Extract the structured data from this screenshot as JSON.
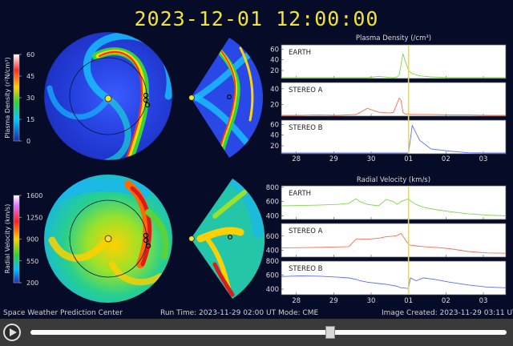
{
  "header": {
    "timestamp": "2023-12-01 12:00:00"
  },
  "footer": {
    "org": "Space Weather Prediction Center",
    "run_time": "Run Time: 2023-11-29 02:00 UT",
    "mode": "Mode: CME",
    "image_created": "Image Created: 2023-11-29 03:11 UT"
  },
  "colorbars": [
    {
      "label": "Plasma Density (r²N/cm³)",
      "ticks": [
        "60",
        "45",
        "30",
        "15",
        "0"
      ]
    },
    {
      "label": "Radial Velocity (km/s)",
      "ticks": [
        "1600",
        "1250",
        "900",
        "550",
        "200"
      ]
    }
  ],
  "colors": {
    "title": "#f2e23a",
    "earth": "#7fd84a",
    "stereo_a": "#ff6b55",
    "stereo_b": "#5a6cff",
    "now_line": "#e8e03a"
  },
  "icons": {
    "play": "play-icon"
  },
  "player": {
    "progress": 0.63
  },
  "chart_data": [
    {
      "type": "line",
      "title": "Plasma Density (/cm³)",
      "x_ticks": [
        "28",
        "29",
        "30",
        "01",
        "02",
        "03",
        "04"
      ],
      "x": [
        0,
        0.5,
        1,
        1.5,
        2,
        2.3,
        2.6,
        2.9,
        3.0,
        3.1,
        3.15,
        3.2,
        3.25,
        3.3,
        3.4,
        3.5,
        3.7,
        4,
        4.5,
        5,
        5.5,
        6
      ],
      "now_x": 3.4,
      "panels": [
        {
          "name": "EARTH",
          "color": "#7fd84a",
          "ylim": [
            5,
            68
          ],
          "yticks": [
            60,
            40,
            20
          ],
          "values": [
            4,
            4,
            4.5,
            4,
            5,
            5,
            9,
            7,
            6,
            8,
            12,
            30,
            52,
            40,
            20,
            14,
            10,
            8,
            6,
            5.5,
            5,
            5
          ]
        },
        {
          "name": "STEREO A",
          "color": "#ff6b55",
          "ylim": [
            5,
            48
          ],
          "yticks": [
            40,
            20
          ],
          "values": [
            6,
            6,
            6.5,
            6,
            7,
            15,
            10,
            9,
            10,
            22,
            28,
            25,
            10,
            8,
            7.5,
            7,
            7,
            7,
            6.5,
            6.5,
            6,
            6
          ]
        },
        {
          "name": "STEREO B",
          "color": "#5a6cff",
          "ylim": [
            5,
            68
          ],
          "yticks": [
            60,
            40,
            20
          ],
          "values": [
            4,
            4,
            4,
            4,
            4.5,
            4.5,
            5,
            5,
            5,
            5,
            5,
            5,
            5,
            5,
            6,
            58,
            30,
            14,
            10,
            7,
            6,
            5
          ]
        }
      ]
    },
    {
      "type": "line",
      "title": "Radial Velocity (km/s)",
      "x_ticks": [
        "28",
        "29",
        "30",
        "01",
        "02",
        "03",
        "04"
      ],
      "x": [
        0,
        0.5,
        1,
        1.5,
        1.8,
        2.0,
        2.1,
        2.3,
        2.6,
        2.8,
        3.0,
        3.1,
        3.2,
        3.4,
        3.45,
        3.6,
        3.8,
        4.1,
        4.5,
        5,
        5.5,
        6
      ],
      "now_x": 3.4,
      "panels": [
        {
          "name": "EARTH",
          "color": "#7fd84a",
          "ylim": [
            350,
            820
          ],
          "yticks": [
            800,
            600,
            400
          ],
          "values": [
            540,
            545,
            550,
            560,
            575,
            640,
            600,
            560,
            540,
            630,
            600,
            560,
            600,
            640,
            610,
            560,
            520,
            490,
            460,
            430,
            410,
            400
          ]
        },
        {
          "name": "STEREO A",
          "color": "#ff6b55",
          "ylim": [
            300,
            780
          ],
          "yticks": [
            600,
            400
          ],
          "values": [
            430,
            435,
            440,
            445,
            450,
            560,
            560,
            555,
            570,
            590,
            600,
            610,
            640,
            480,
            470,
            460,
            450,
            440,
            420,
            380,
            360,
            355
          ]
        },
        {
          "name": "STEREO B",
          "color": "#5a6cff",
          "ylim": [
            320,
            800
          ],
          "yticks": [
            800,
            600,
            400
          ],
          "values": [
            580,
            590,
            585,
            570,
            560,
            540,
            520,
            500,
            480,
            470,
            450,
            440,
            420,
            410,
            560,
            520,
            560,
            540,
            500,
            460,
            430,
            420
          ]
        }
      ]
    }
  ]
}
